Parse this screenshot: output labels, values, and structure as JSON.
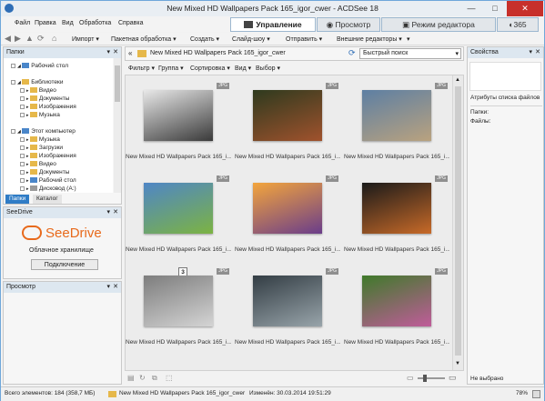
{
  "window": {
    "title": "New Mixed HD Wallpapers Pack 165_igor_cwer - ACDSee 18",
    "minimize": "—",
    "maximize": "□",
    "close": "✕"
  },
  "menu": [
    "Файл",
    "Правка",
    "Вид",
    "Обработка",
    "Справка"
  ],
  "modes": [
    {
      "label": "Управление",
      "active": true
    },
    {
      "label": "Просмотр",
      "active": false
    },
    {
      "label": "Режим редактора",
      "active": false
    },
    {
      "label": "365",
      "active": false
    }
  ],
  "toolbar": [
    "Импорт",
    "Пакетная обработка",
    "Создать",
    "Слайд-шоу",
    "Отправить",
    "Внешние редакторы"
  ],
  "folders_panel": {
    "title": "Папки",
    "tree": [
      {
        "label": "Рабочий стол",
        "indent": 1,
        "color": "#4a86c9"
      },
      {
        "label": "Библиотеки",
        "indent": 1,
        "color": "#e6b84a"
      },
      {
        "label": "Видео",
        "indent": 2,
        "color": "#e6b84a"
      },
      {
        "label": "Документы",
        "indent": 2,
        "color": "#e6b84a"
      },
      {
        "label": "Изображения",
        "indent": 2,
        "color": "#e6b84a"
      },
      {
        "label": "Музыка",
        "indent": 2,
        "color": "#e6b84a"
      },
      {
        "label": "Этот компьютер",
        "indent": 1,
        "color": "#4a86c9"
      },
      {
        "label": "Музыка",
        "indent": 2,
        "color": "#e6b84a"
      },
      {
        "label": "Загрузки",
        "indent": 2,
        "color": "#e6b84a"
      },
      {
        "label": "Изображения",
        "indent": 2,
        "color": "#e6b84a"
      },
      {
        "label": "Видео",
        "indent": 2,
        "color": "#e6b84a"
      },
      {
        "label": "Документы",
        "indent": 2,
        "color": "#e6b84a"
      },
      {
        "label": "Рабочий стол",
        "indent": 2,
        "color": "#4a86c9"
      },
      {
        "label": "Дисковод (A:)",
        "indent": 2,
        "color": "#9a9a9a"
      }
    ],
    "tabs": [
      "Папки",
      "Каталог"
    ]
  },
  "seedrive": {
    "title": "SeeDrive",
    "logo": "SeeDrive",
    "subtitle": "Облачное хранилище",
    "button": "Подключение"
  },
  "preview": {
    "title": "Просмотр"
  },
  "path": {
    "text": "New Mixed HD Wallpapers Pack 165_igor_cwer",
    "search_placeholder": "Быстрый поиск"
  },
  "filterbar": [
    "Фильтр",
    "Группа",
    "Сортировка",
    "Вид",
    "Выбор"
  ],
  "badge": "JPG",
  "thumbnails": [
    {
      "caption": "New Mixed HD Wallpapers Pack 165_i...",
      "colors": [
        "#e8e8e8",
        "#3a3a3a"
      ]
    },
    {
      "caption": "New Mixed HD Wallpapers Pack 165_i...",
      "colors": [
        "#2e3a1e",
        "#a0522d"
      ]
    },
    {
      "caption": "New Mixed HD Wallpapers Pack 165_i...",
      "colors": [
        "#5d7fa3",
        "#b9a27f"
      ]
    },
    {
      "caption": "New Mixed HD Wallpapers Pack 165_i...",
      "colors": [
        "#4f86c6",
        "#7cb342"
      ]
    },
    {
      "caption": "New Mixed HD Wallpapers Pack 165_i...",
      "colors": [
        "#f3a53c",
        "#6a3d8a"
      ]
    },
    {
      "caption": "New Mixed HD Wallpapers Pack 165_i...",
      "colors": [
        "#1a1a1a",
        "#c86a28"
      ]
    },
    {
      "caption": "New Mixed HD Wallpapers Pack 165_i...",
      "colors": [
        "#7d7d7d",
        "#d4d4d4"
      ]
    },
    {
      "caption": "New Mixed HD Wallpapers Pack 165_i...",
      "colors": [
        "#333d44",
        "#98a4aa"
      ]
    },
    {
      "caption": "New Mixed HD Wallpapers Pack 165_i...",
      "colors": [
        "#3f7a2a",
        "#c05c9a"
      ]
    }
  ],
  "row3_number": "3",
  "properties": {
    "title": "Свойства",
    "section": "Атрибуты списка файлов",
    "folders_label": "Папки:",
    "files_label": "Файлы:",
    "footer": "Не выбрано"
  },
  "status": {
    "total": "Всего элементов: 184  (358,7 МБ)",
    "folder": "New Mixed HD Wallpapers Pack 165_igor_cwer",
    "modified": "Изменён: 30.03.2014 19:51:29",
    "zoom": "78%"
  }
}
